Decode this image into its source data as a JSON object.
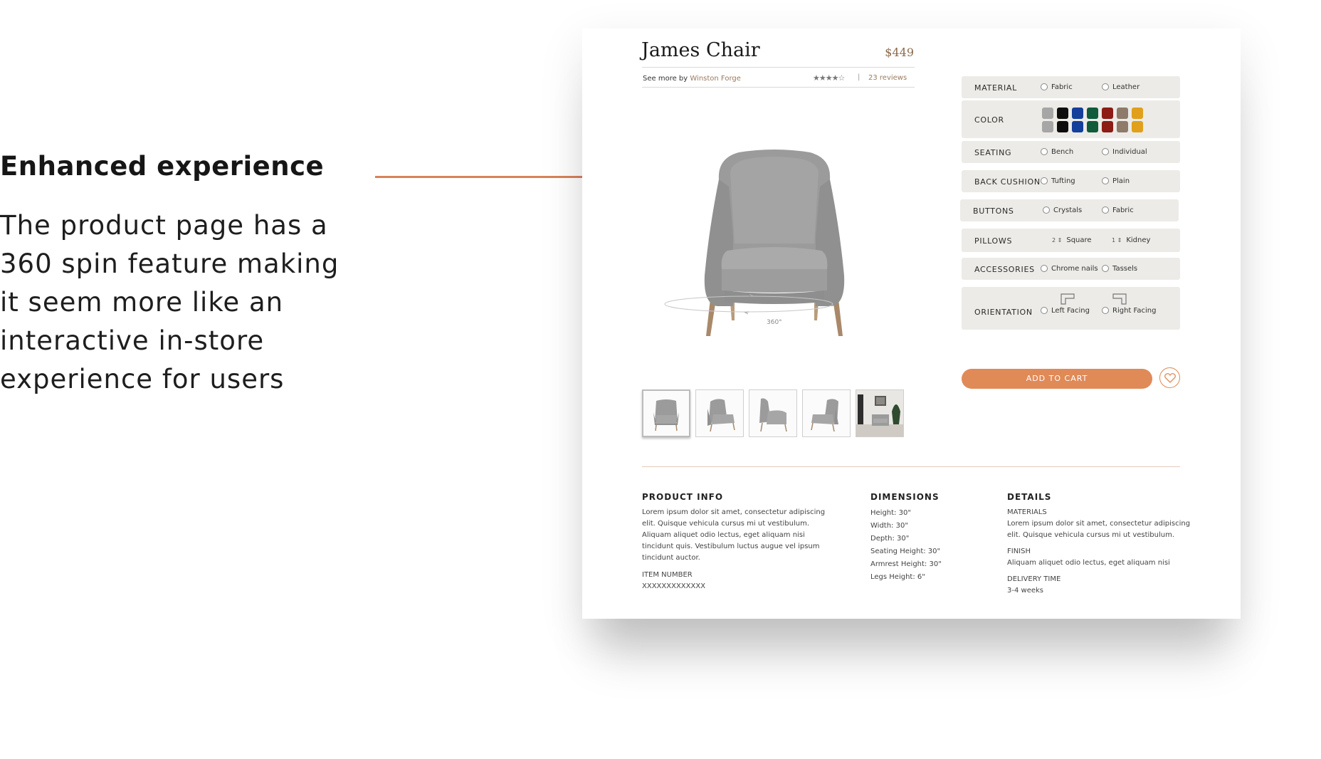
{
  "annotation": {
    "heading": "Enhanced experience",
    "body_lines": [
      "The product page has a",
      "360 spin feature  making",
      "it seem more like an",
      "interactive in-store",
      "experience for users"
    ],
    "accent_color": "#d9825a"
  },
  "product": {
    "name": "James Chair",
    "price": "$449",
    "see_more_prefix": "See more by",
    "brand": "Winston Forge",
    "rating_stars": "★★★★☆",
    "rating": 4,
    "separator": "|",
    "reviews": "23 reviews",
    "spin_label": "360°"
  },
  "options": {
    "material": {
      "label": "MATERIAL",
      "choices": [
        "Fabric",
        "Leather"
      ]
    },
    "color": {
      "label": "COLOR",
      "swatches_top": [
        "#a6a6a6",
        "#0d0d0d",
        "#143f9a",
        "#0f5b3a",
        "#8c1c14",
        "#8f7b6a",
        "#e0a01b"
      ],
      "swatches_bottom": [
        "#a6a6a6",
        "#0d0d0d",
        "#143f9a",
        "#0f5b3a",
        "#8c1c14",
        "#8f7b6a",
        "#e0a01b"
      ]
    },
    "seating": {
      "label": "SEATING",
      "choices": [
        "Bench",
        "Individual"
      ]
    },
    "back_cushion": {
      "label": "BACK CUSHION",
      "choices": [
        "Tufting",
        "Plain"
      ]
    },
    "buttons": {
      "label": "BUTTONS",
      "choices": [
        "Crystals",
        "Fabric"
      ]
    },
    "pillows": {
      "label": "PILLOWS",
      "choices": [
        "Square",
        "Kidney"
      ],
      "quantities": [
        "2",
        "1"
      ]
    },
    "accessories": {
      "label": "ACCESSORIES",
      "choices": [
        "Chrome nails",
        "Tassels"
      ]
    },
    "orientation": {
      "label": "ORIENTATION",
      "choices": [
        "Left Facing",
        "Right Facing"
      ]
    }
  },
  "actions": {
    "add_to_cart": "ADD TO CART",
    "accent_color": "#e08a58"
  },
  "info": {
    "product_info": {
      "heading": "PRODUCT INFO",
      "lines": [
        "Lorem ipsum dolor sit amet, consectetur adipiscing",
        "elit. Quisque vehicula cursus mi ut vestibulum.",
        "Aliquam aliquet odio lectus, eget aliquam nisi",
        "tincidunt quis. Vestibulum luctus augue vel ipsum",
        "tincidunt auctor."
      ],
      "item_number_label": "ITEM NUMBER",
      "item_number": "XXXXXXXXXXXXX"
    },
    "dimensions": {
      "heading": "DIMENSIONS",
      "lines": [
        "Height: 30\"",
        "Width: 30\"",
        "Depth: 30\"",
        "Seating Height: 30\"",
        "Armrest Height: 30\"",
        "Legs Height: 6\""
      ]
    },
    "details": {
      "heading": "DETAILS",
      "materials_label": "MATERIALS",
      "materials_lines": [
        "Lorem ipsum dolor sit amet, consectetur adipiscing",
        "elit. Quisque vehicula cursus mi ut vestibulum."
      ],
      "finish_label": "FINISH",
      "finish_text": "Aliquam aliquet odio lectus, eget aliquam nisi",
      "delivery_label": "DELIVERY TIME",
      "delivery_text": "3-4 weeks"
    }
  }
}
